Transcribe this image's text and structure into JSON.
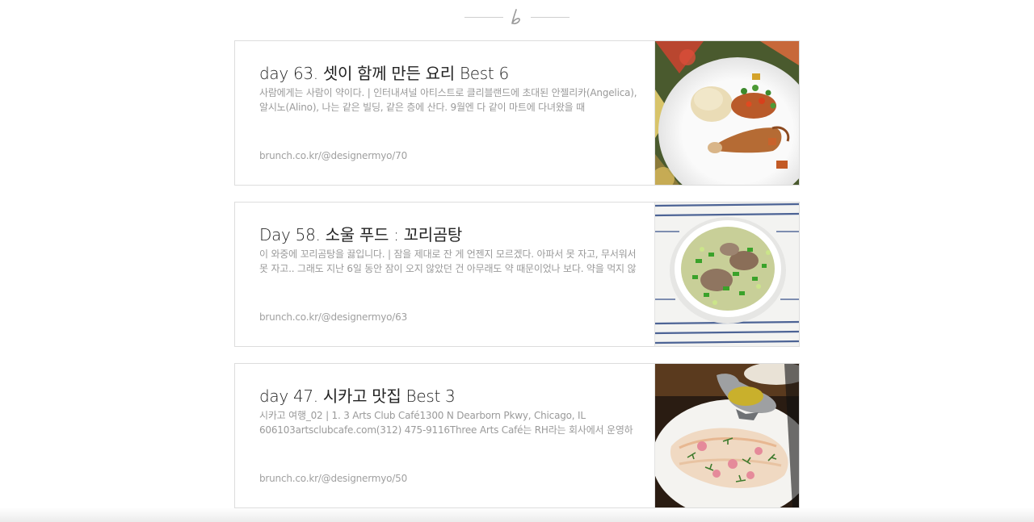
{
  "posts": [
    {
      "title": "day 63. 셋이 함께 만든 요리 Best 6",
      "description": "사람에게는 사람이 약이다. | 인터내셔널 아티스트로 클리블랜드에 초대된 안젤리카(Angelica), 알시노(Alino), 나는 같은 빌딩, 같은 층에 산다. 9월엔 다 같이 마트에 다녀왔을 때",
      "url": "brunch.co.kr/@designermyo/70",
      "thumbnail_icon": "chicken-rice-plate-photo"
    },
    {
      "title": "Day 58. 소울 푸드 : 꼬리곰탕",
      "description": "이 와중에 꼬리곰탕을 끓입니다. | 잠을 제대로 잔 게 언젠지 모르겠다. 아파서 못 자고, 무서워서 못 자고.. 그래도 지난 6일 동안 잠이 오지 않았던 건 아무래도 약 때문이었나 보다. 약을 먹지 않",
      "url": "brunch.co.kr/@designermyo/63",
      "thumbnail_icon": "oxtail-soup-bowl-photo"
    },
    {
      "title": "day 47. 시카고 맛집 Best 3",
      "description": "시카고 여행_02 | 1. 3 Arts Club Café1300 N Dearborn Pkwy, Chicago, IL 606103artsclubcafe.com(312) 475-9116Three Arts Café는 RH라는 회사에서 운영하는 곳",
      "url": "brunch.co.kr/@designermyo/50",
      "thumbnail_icon": "fish-dish-with-sauce-photo"
    }
  ],
  "logo_icon": "brunch-b-logo-icon"
}
